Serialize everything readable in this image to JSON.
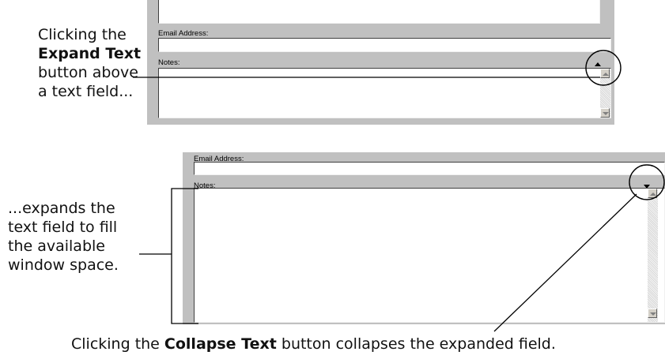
{
  "top_caption": {
    "line1": "Clicking the",
    "line2_bold": "Expand Text",
    "line3": "button above",
    "line4": "a text field..."
  },
  "window_top": {
    "email_label": "Email Address:",
    "notes_label": "Notes:",
    "expand_icon": "triangle-up-icon",
    "scroll_up_icon": "scroll-up-arrow-icon",
    "scroll_down_icon": "scroll-down-arrow-icon"
  },
  "window_bottom": {
    "email_label": "Email Address:",
    "notes_label": "Notes:",
    "collapse_icon": "triangle-down-icon",
    "scroll_up_icon": "scroll-up-arrow-icon",
    "scroll_down_icon": "scroll-down-arrow-icon"
  },
  "mid_caption": {
    "line1": "...expands the",
    "line2": "text field to fill",
    "line3": "the available",
    "line4": "window space."
  },
  "bottom_caption": {
    "prefix": "Clicking the ",
    "bold": "Collapse Text",
    "suffix": " button collapses the expanded field."
  },
  "colors": {
    "window_bg": "#c0c0c0",
    "field_bg": "#ffffff",
    "callout_line": "#000000"
  }
}
